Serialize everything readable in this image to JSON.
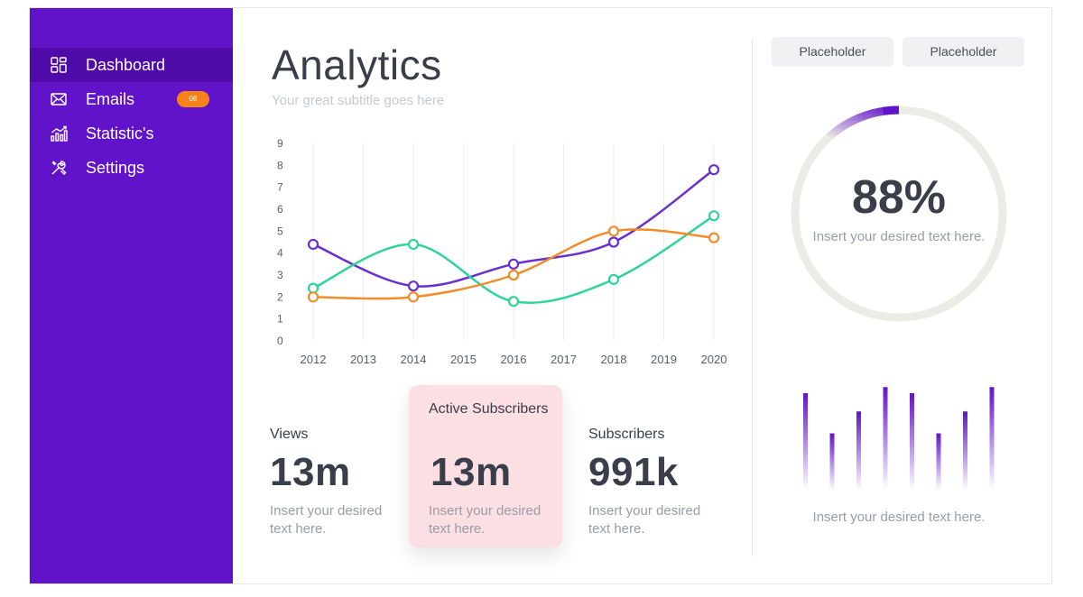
{
  "sidebar": {
    "items": [
      {
        "label": "Dashboard",
        "icon": "dashboard-icon",
        "active": true
      },
      {
        "label": "Emails",
        "icon": "mail-icon",
        "badge": "08"
      },
      {
        "label": "Statistic's",
        "icon": "statistics-icon"
      },
      {
        "label": "Settings",
        "icon": "settings-icon"
      }
    ],
    "bg": "#6113c9",
    "active_bg": "#4f0aa8",
    "badge_color": "#f7821b"
  },
  "header": {
    "title": "Analytics",
    "subtitle": "Your great subtitle goes here"
  },
  "chart_data": {
    "type": "line",
    "x": [
      2012,
      2013,
      2014,
      2015,
      2016,
      2017,
      2018,
      2019,
      2020
    ],
    "ylim": [
      0,
      9
    ],
    "yticks": [
      0,
      1,
      2,
      3,
      4,
      5,
      6,
      7,
      8,
      9
    ],
    "grid": "vertical",
    "series": [
      {
        "color": "#6a2fd0",
        "points": [
          [
            2012,
            4.4
          ],
          [
            2014,
            2.5
          ],
          [
            2016,
            3.5
          ],
          [
            2018,
            4.5
          ],
          [
            2020,
            7.8
          ]
        ]
      },
      {
        "color": "#2fd39b",
        "points": [
          [
            2012,
            2.4
          ],
          [
            2014,
            4.4
          ],
          [
            2016,
            1.8
          ],
          [
            2018,
            2.8
          ],
          [
            2020,
            5.7
          ]
        ]
      },
      {
        "color": "#f28c28",
        "points": [
          [
            2012,
            2.0
          ],
          [
            2014,
            2.0
          ],
          [
            2016,
            3.0
          ],
          [
            2018,
            5.0
          ],
          [
            2020,
            4.7
          ]
        ]
      }
    ]
  },
  "stats": [
    {
      "label": "Views",
      "value": "13m",
      "desc": "Insert your desired text here."
    },
    {
      "label": "Active Subscribers",
      "value": "13m",
      "desc": "Insert your desired text here.",
      "highlight": true
    },
    {
      "label": "Subscribers",
      "value": "991k",
      "desc": "Insert your desired text here."
    }
  ],
  "right_panel": {
    "buttons": [
      "Placeholder",
      "Placeholder"
    ],
    "progress": {
      "value_text": "88%",
      "fraction": 0.12,
      "desc": "Insert your desired text here.",
      "color": "#6113c9",
      "track": "#ecece6"
    },
    "bars": {
      "values": [
        0.8,
        0.47,
        0.65,
        0.85,
        0.8,
        0.47,
        0.65,
        0.85
      ],
      "desc": "Insert your desired text here.",
      "color": "#6113c9"
    }
  }
}
